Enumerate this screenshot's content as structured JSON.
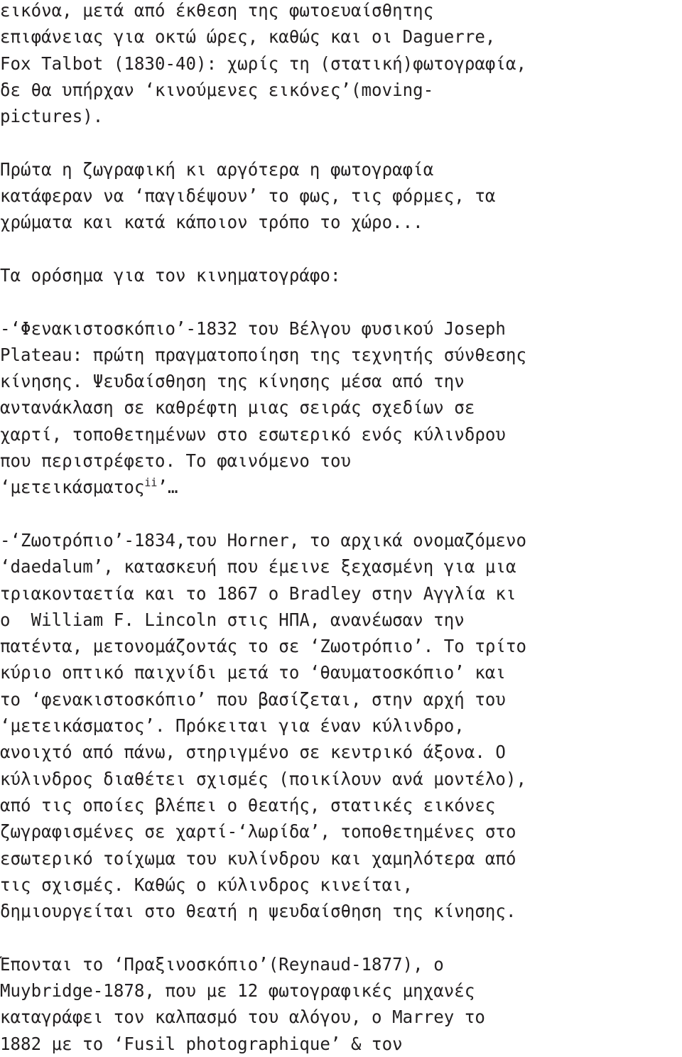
{
  "document": {
    "language": "el",
    "text_color": "#221f20",
    "background_color": "#ffffff",
    "paragraphs": [
      {
        "id": "p1",
        "lines": [
          "εικόνα, μετά από έκθεση της φωτοευαίσθητης",
          "επιφάνειας για οκτώ ώρες, καθώς και οι Daguerre,",
          "Fox Talbot (1830-40): χωρίς τη (στατική)φωτογραφία,",
          "δε θα υπήρχαν ‘κινούμενες εικόνες’(moving-",
          "pictures)."
        ]
      },
      {
        "id": "p2",
        "lines": [
          "Πρώτα η ζωγραφική κι αργότερα η φωτογραφία",
          "κατάφεραν να ‘παγιδέψουν’ το φως, τις φόρμες, τα",
          "χρώματα και κατά κάποιον τρόπο το χώρο..."
        ]
      },
      {
        "id": "p3",
        "lines": [
          "Τα ορόσημα για τον κινηματογράφο:"
        ]
      },
      {
        "id": "p4",
        "lines": [
          "-‘Φενακιστοσκόπιο’-1832 του Βέλγου φυσικού Joseph",
          "Plateau: πρώτη πραγματοποίηση της τεχνητής σύνθεσης",
          "κίνησης. Ψευδαίσθηση της κίνησης μέσα από την",
          "αντανάκλαση σε καθρέφτη μιας σειράς σχεδίων σε",
          "χαρτί, τοποθετημένων στο εσωτερικό ενός κύλινδρου",
          "που περιστρέφετο. Το φαινόμενο του"
        ],
        "final_line": {
          "before": "‘μετεικάσματος",
          "superscript": "ii",
          "after": "’…"
        }
      },
      {
        "id": "p5",
        "lines": [
          "-‘Ζωοτρόπιο’-1834,του Horner, το αρχικά ονομαζόμενο",
          "‘daedalum’, κατασκευή που έμεινε ξεχασμένη για μια",
          "τριακονταετία και το 1867 ο Bradley στην Αγγλία κι",
          "ο  William F. Lincoln στις ΗΠΑ, ανανέωσαν την",
          "πατέντα, μετονομάζοντάς το σε ‘Ζωοτρόπιο’. Το τρίτο",
          "κύριο οπτικό παιχνίδι μετά το ‘θαυματοσκόπιο’ και",
          "το ‘φενακιστοσκόπιο’ που βασίζεται, στην αρχή του",
          "‘μετεικάσματος’. Πρόκειται για έναν κύλινδρο,",
          "ανοιχτό από πάνω, στηριγμένο σε κεντρικό άξονα. Ο",
          "κύλινδρος διαθέτει σχισμές (ποικίλουν ανά μοντέλο),",
          "από τις οποίες βλέπει ο θεατής, στατικές εικόνες",
          "ζωγραφισμένες σε χαρτί-‘λωρίδα’, τοποθετημένες στο",
          "εσωτερικό τοίχωμα του κυλίνδρου και χαμηλότερα από",
          "τις σχισμές. Καθώς ο κύλινδρος κινείται,",
          "δημιουργείται στο θεατή η ψευδαίσθηση της κίνησης."
        ]
      },
      {
        "id": "p6",
        "lines": [
          "Έπονται το ‘Πραξινοσκόπιο’(Reynaud-1877), ο",
          "Muybridge-1878, που με 12 φωτογραφικές μηχανές",
          "καταγράφει τον καλπασμό του αλόγου, ο Marrey το",
          "1882 με το ‘Fusil photographique’ & τον"
        ]
      }
    ]
  }
}
